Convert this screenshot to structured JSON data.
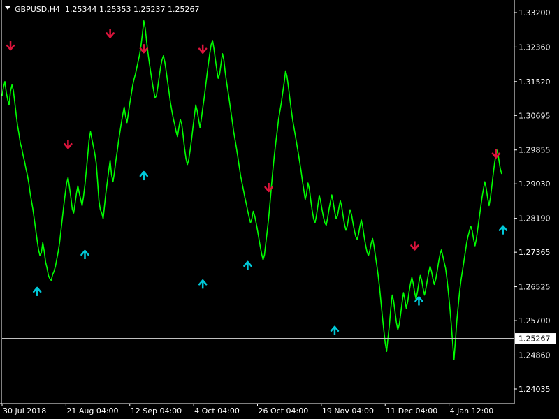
{
  "header": {
    "symbol": "GBPUSD,H4",
    "ohlc": "1.25344 1.25353 1.25237 1.25267"
  },
  "colors": {
    "background": "#000000",
    "price_line": "#00ff00",
    "sell_arrow": "#dc143c",
    "buy_arrow": "#00c8d8",
    "axis": "#ffffff",
    "current_price_line": "#c0c0c0"
  },
  "chart_data": {
    "type": "line",
    "title": "GBPUSD,H4",
    "xlabel": "",
    "ylabel": "",
    "grid": false,
    "ylim": [
      1.2355,
      1.337
    ],
    "y_ticks": [
      "1.33200",
      "1.32360",
      "1.31520",
      "1.30695",
      "1.29855",
      "1.29030",
      "1.28190",
      "1.27365",
      "1.26525",
      "1.25700",
      "1.24860",
      "1.24035"
    ],
    "x_ticks": [
      "30 Jul 2018",
      "21 Aug 04:00",
      "12 Sep 04:00",
      "4 Oct 04:00",
      "26 Oct 04:00",
      "19 Nov 04:00",
      "11 Dec 04:00",
      "4 Jan 12:00"
    ],
    "current_price": "1.25267",
    "x": [
      0,
      1,
      2,
      3,
      4,
      5,
      6,
      7,
      8,
      9,
      10,
      11,
      12,
      13,
      14,
      15,
      16,
      17,
      18,
      19,
      20,
      21,
      22,
      23,
      24,
      25,
      26,
      27,
      28,
      29,
      30,
      31,
      32,
      33,
      34,
      35,
      36,
      37,
      38,
      39,
      40,
      41,
      42,
      43,
      44,
      45,
      46,
      47,
      48,
      49,
      50,
      51,
      52,
      53,
      54,
      55,
      56,
      57,
      58,
      59,
      60,
      61,
      62,
      63,
      64,
      65,
      66,
      67,
      68,
      69,
      70,
      71,
      72,
      73,
      74,
      75,
      76,
      77,
      78,
      79,
      80,
      81,
      82,
      83,
      84,
      85,
      86,
      87,
      88,
      89,
      90,
      91,
      92,
      93,
      94,
      95,
      96,
      97,
      98,
      99,
      100,
      101,
      102,
      103,
      104,
      105,
      106,
      107,
      108,
      109,
      110,
      111,
      112,
      113,
      114,
      115,
      116,
      117,
      118,
      119,
      120,
      121,
      122,
      123,
      124,
      125,
      126,
      127,
      128,
      129,
      130,
      131,
      132,
      133,
      134,
      135,
      136,
      137,
      138,
      139,
      140,
      141,
      142,
      143,
      144,
      145,
      146,
      147,
      148,
      149,
      150,
      151,
      152,
      153,
      154,
      155,
      156,
      157,
      158,
      159,
      160,
      161,
      162,
      163,
      164,
      165,
      166,
      167,
      168,
      169,
      170,
      171,
      172,
      173,
      174,
      175,
      176,
      177,
      178,
      179,
      180,
      181,
      182,
      183,
      184,
      185,
      186,
      187,
      188,
      189,
      190,
      191,
      192,
      193,
      194,
      195,
      196,
      197,
      198,
      199,
      200,
      201,
      202,
      203,
      204,
      205,
      206,
      207,
      208,
      209,
      210,
      211,
      212,
      213,
      214,
      215,
      216,
      217,
      218,
      219,
      220,
      221,
      222,
      223,
      224,
      225,
      226,
      227,
      228,
      229,
      230,
      231,
      232,
      233,
      234,
      235,
      236,
      237,
      238,
      239,
      240,
      241,
      242,
      243,
      244,
      245,
      246,
      247,
      248,
      249,
      250,
      251,
      252,
      253,
      254,
      255,
      256,
      257,
      258,
      259,
      260,
      261,
      262,
      263,
      264,
      265,
      266,
      267,
      268,
      269,
      270,
      271,
      272,
      273,
      274,
      275,
      276,
      277,
      278,
      279,
      280,
      281,
      282,
      283,
      284,
      285,
      286,
      287,
      288,
      289,
      290,
      291,
      292,
      293,
      294,
      295,
      296,
      297,
      298,
      299,
      300,
      301,
      302,
      303,
      304,
      305,
      306,
      307,
      308,
      309,
      310,
      311,
      312,
      313,
      314,
      315,
      316,
      317,
      318,
      319,
      320,
      321,
      322,
      323,
      324,
      325,
      326,
      327,
      328,
      329,
      330,
      331,
      332,
      333,
      334,
      335,
      336,
      337,
      338,
      339,
      340,
      341,
      342,
      343,
      344,
      345,
      346,
      347,
      348,
      349,
      350,
      351,
      352,
      353,
      354,
      355,
      356,
      357,
      358,
      359,
      360,
      361,
      362,
      363,
      364
    ],
    "series": [
      {
        "values": [
          1.3117,
          1.3138,
          1.3152,
          1.3125,
          1.3108,
          1.3095,
          1.3128,
          1.3144,
          1.313,
          1.3102,
          1.3072,
          1.3045,
          1.3025,
          1.3002,
          1.299,
          1.2972,
          1.2958,
          1.294,
          1.2925,
          1.2905,
          1.288,
          1.286,
          1.284,
          1.2815,
          1.279,
          1.2765,
          1.2742,
          1.2728,
          1.2735,
          1.276,
          1.274,
          1.2712,
          1.2698,
          1.268,
          1.2672,
          1.2668,
          1.2682,
          1.269,
          1.2702,
          1.272,
          1.2738,
          1.276,
          1.279,
          1.2822,
          1.2852,
          1.288,
          1.2905,
          1.2918,
          1.2895,
          1.287,
          1.2842,
          1.2832,
          1.2855,
          1.288,
          1.2898,
          1.288,
          1.2865,
          1.285,
          1.2872,
          1.29,
          1.2935,
          1.2972,
          1.301,
          1.303,
          1.3012,
          1.2995,
          1.2978,
          1.2955,
          1.291,
          1.2862,
          1.284,
          1.2832,
          1.2818,
          1.285,
          1.2882,
          1.2908,
          1.2935,
          1.296,
          1.2925,
          1.2908,
          1.293,
          1.2958,
          1.2982,
          1.3008,
          1.303,
          1.3052,
          1.3072,
          1.309,
          1.3068,
          1.3052,
          1.3075,
          1.31,
          1.312,
          1.3142,
          1.3158,
          1.317,
          1.3186,
          1.3202,
          1.3218,
          1.324,
          1.3268,
          1.33,
          1.3282,
          1.325,
          1.322,
          1.3195,
          1.3172,
          1.315,
          1.313,
          1.3112,
          1.3118,
          1.314,
          1.3165,
          1.3188,
          1.3205,
          1.3215,
          1.3198,
          1.3175,
          1.315,
          1.3125,
          1.31,
          1.308,
          1.3062,
          1.3048,
          1.303,
          1.3018,
          1.304,
          1.306,
          1.3048,
          1.302,
          1.299,
          1.2965,
          1.295,
          1.2962,
          1.2985,
          1.301,
          1.304,
          1.3068,
          1.3095,
          1.3082,
          1.306,
          1.304,
          1.3062,
          1.3088,
          1.3112,
          1.314,
          1.3168,
          1.3195,
          1.322,
          1.3242,
          1.3252,
          1.3232,
          1.3205,
          1.318,
          1.316,
          1.317,
          1.3195,
          1.322,
          1.3205,
          1.3175,
          1.315,
          1.3128,
          1.3105,
          1.308,
          1.3055,
          1.303,
          1.301,
          1.299,
          1.2968,
          1.2945,
          1.2922,
          1.2905,
          1.2888,
          1.287,
          1.2855,
          1.2838,
          1.2822,
          1.2808,
          1.2818,
          1.2836,
          1.2825,
          1.2808,
          1.279,
          1.277,
          1.275,
          1.2732,
          1.2718,
          1.273,
          1.276,
          1.279,
          1.2822,
          1.286,
          1.29,
          1.2938,
          1.2972,
          1.3002,
          1.303,
          1.306,
          1.308,
          1.31,
          1.3125,
          1.315,
          1.3178,
          1.3165,
          1.314,
          1.3112,
          1.3085,
          1.306,
          1.304,
          1.302,
          1.3,
          1.298,
          1.2958,
          1.2935,
          1.291,
          1.2888,
          1.2865,
          1.288,
          1.2905,
          1.289,
          1.2862,
          1.2838,
          1.2818,
          1.2808,
          1.2825,
          1.285,
          1.2875,
          1.286,
          1.284,
          1.2822,
          1.2808,
          1.2802,
          1.282,
          1.2842,
          1.286,
          1.2876,
          1.2858,
          1.2835,
          1.2818,
          1.2825,
          1.2845,
          1.2862,
          1.2848,
          1.2825,
          1.2805,
          1.279,
          1.28,
          1.2822,
          1.284,
          1.2828,
          1.2808,
          1.279,
          1.2775,
          1.2768,
          1.278,
          1.28,
          1.2815,
          1.2798,
          1.2775,
          1.2755,
          1.2738,
          1.2728,
          1.274,
          1.2758,
          1.277,
          1.2752,
          1.2728,
          1.2705,
          1.268,
          1.265,
          1.2615,
          1.258,
          1.2548,
          1.2515,
          1.2495,
          1.2528,
          1.256,
          1.26,
          1.2632,
          1.2618,
          1.2592,
          1.2565,
          1.2548,
          1.256,
          1.2585,
          1.2612,
          1.2638,
          1.2622,
          1.26,
          1.2615,
          1.264,
          1.266,
          1.2675,
          1.266,
          1.2638,
          1.2622,
          1.264,
          1.2662,
          1.268,
          1.2668,
          1.2648,
          1.2632,
          1.2648,
          1.2668,
          1.2688,
          1.2702,
          1.269,
          1.2672,
          1.2658,
          1.267,
          1.269,
          1.2712,
          1.273,
          1.2742,
          1.2728,
          1.2712,
          1.2698,
          1.2672,
          1.264,
          1.2605,
          1.2565,
          1.252,
          1.2475,
          1.252,
          1.2568,
          1.2605,
          1.264,
          1.2668,
          1.269,
          1.2712,
          1.2735,
          1.2758,
          1.2775,
          1.2788,
          1.28,
          1.2788,
          1.2768,
          1.2752,
          1.277,
          1.2795,
          1.282,
          1.2845,
          1.287,
          1.289,
          1.2908,
          1.2892,
          1.2868,
          1.285,
          1.287,
          1.2898,
          1.2928,
          1.2955,
          1.2975,
          1.2985,
          1.2962,
          1.294,
          1.2927
        ]
      }
    ],
    "sell_arrows": [
      {
        "x": 6,
        "y": 1.324
      },
      {
        "x": 47,
        "y": 1.3
      },
      {
        "x": 77,
        "y": 1.327
      },
      {
        "x": 101,
        "y": 1.3233
      },
      {
        "x": 143,
        "y": 1.3232
      },
      {
        "x": 190,
        "y": 1.2895
      },
      {
        "x": 294,
        "y": 1.2753
      },
      {
        "x": 352,
        "y": 1.2977
      }
    ],
    "buy_arrows": [
      {
        "x": 25,
        "y": 1.264
      },
      {
        "x": 59,
        "y": 1.273
      },
      {
        "x": 101,
        "y": 1.2922
      },
      {
        "x": 143,
        "y": 1.2658
      },
      {
        "x": 175,
        "y": 1.2703
      },
      {
        "x": 237,
        "y": 1.2545
      },
      {
        "x": 297,
        "y": 1.2617
      },
      {
        "x": 357,
        "y": 1.279
      }
    ]
  }
}
